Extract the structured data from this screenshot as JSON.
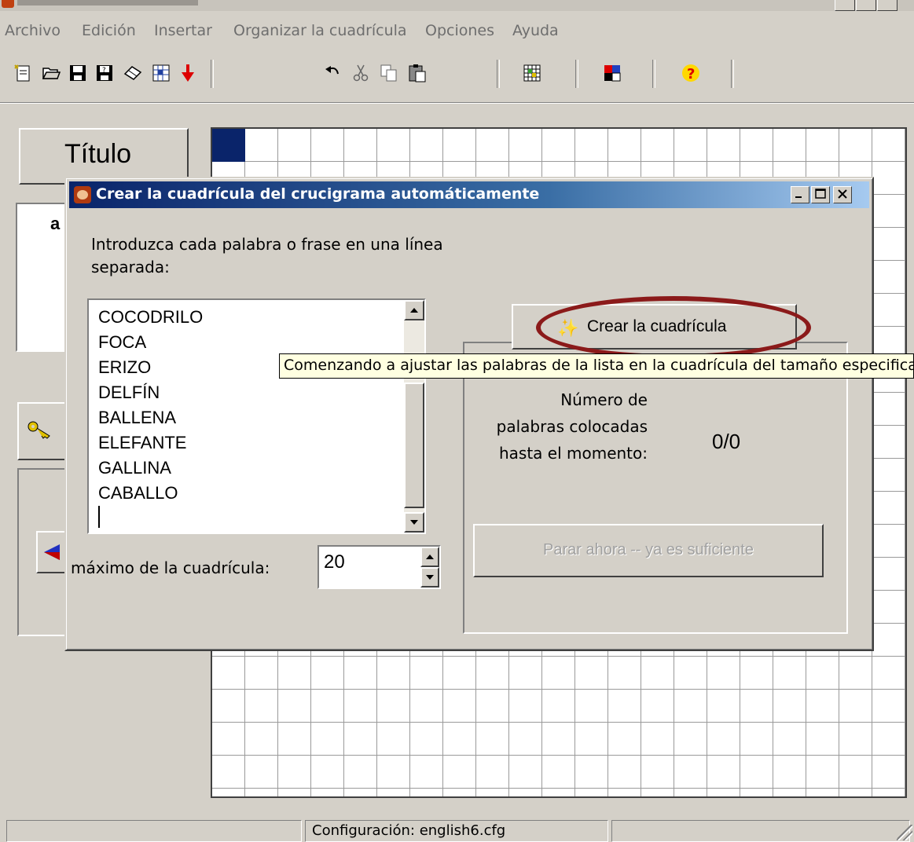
{
  "menu": [
    "Archivo",
    "Edición",
    "Insertar",
    "Organizar la cuadrícula",
    "Opciones",
    "Ayuda"
  ],
  "toolbar_icons": [
    "new-document-icon",
    "open-folder-icon",
    "save-icon",
    "save-as-icon",
    "erase-icon",
    "puzzle-icon",
    "down-arrow-icon",
    "undo-icon",
    "cut-icon",
    "copy-icon",
    "paste-icon",
    "grid-wizard-icon",
    "palette-icon",
    "help-icon"
  ],
  "left_panel": {
    "title": "Título",
    "partial_text": "a"
  },
  "dialog": {
    "title": "Crear la cuadrícula del crucigrama automáticamente",
    "instruction": "Introduzca cada palabra o frase en una línea separada:",
    "words": [
      "COCODRILO",
      "FOCA",
      "ERIZO",
      "DELFÍN",
      "BALLENA",
      "ELEFANTE",
      "GALLINA",
      "CABALLO"
    ],
    "max_label": "máximo de la cuadrícula:",
    "max_value": "20",
    "create_button": "Crear la cuadrícula",
    "count_label": "Número de palabras colocadas hasta el momento:",
    "count_value": "0/0",
    "stop_button": "Parar ahora -- ya es suficiente"
  },
  "tooltip": "Comenzando a ajustar las palabras de la lista en la cuadrícula del tamaño especificado",
  "status": {
    "config": "Configuración: english6.cfg"
  },
  "colors": {
    "accent": "#0a246a",
    "highlight_oval": "#8b1a1a",
    "tooltip_bg": "#ffffe1"
  }
}
